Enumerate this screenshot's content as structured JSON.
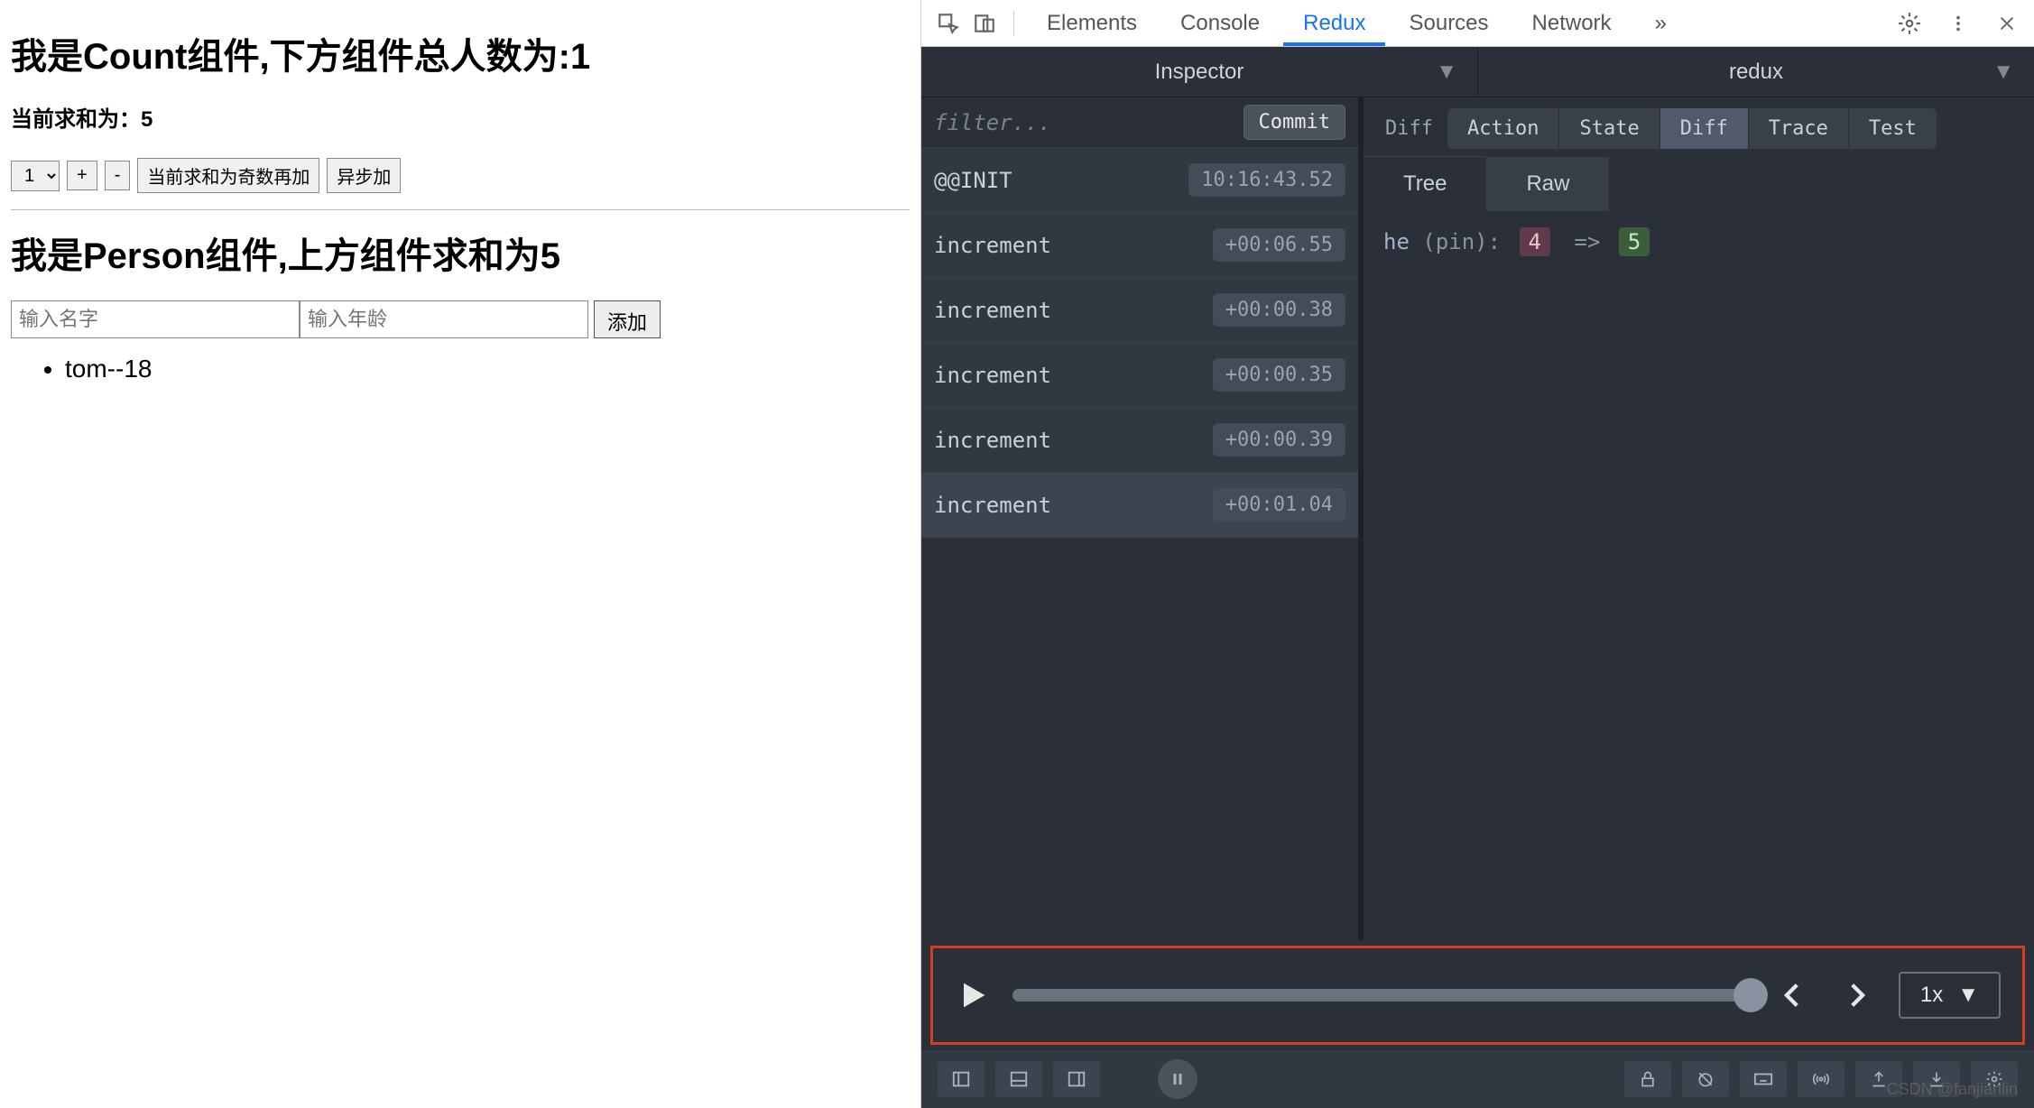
{
  "app": {
    "count_heading": "我是Count组件,下方组件总人数为:1",
    "sum_line": "当前求和为：5",
    "select_value": "1",
    "inc_btn": "+",
    "dec_btn": "-",
    "odd_btn": "当前求和为奇数再加",
    "async_btn": "异步加",
    "person_heading": "我是Person组件,上方组件求和为5",
    "name_placeholder": "输入名字",
    "age_placeholder": "输入年龄",
    "add_btn": "添加",
    "persons": [
      "tom--18"
    ]
  },
  "devtools": {
    "tabs": [
      "Elements",
      "Console",
      "Redux",
      "Sources",
      "Network"
    ],
    "active_tab": "Redux",
    "more": "»"
  },
  "redux": {
    "selectors": {
      "left": "Inspector",
      "right": "redux"
    },
    "filter_placeholder": "filter...",
    "commit": "Commit",
    "actions": [
      {
        "name": "@@INIT",
        "time": "10:16:43.52",
        "selected": false
      },
      {
        "name": "increment",
        "time": "+00:06.55",
        "selected": false
      },
      {
        "name": "increment",
        "time": "+00:00.38",
        "selected": false
      },
      {
        "name": "increment",
        "time": "+00:00.35",
        "selected": false
      },
      {
        "name": "increment",
        "time": "+00:00.39",
        "selected": false
      },
      {
        "name": "increment",
        "time": "+00:01.04",
        "selected": true
      }
    ],
    "view_label": "Diff",
    "view_tabs": [
      "Action",
      "State",
      "Diff",
      "Trace",
      "Test"
    ],
    "view_active": "Diff",
    "subview_tabs": [
      "Tree",
      "Raw"
    ],
    "subview_active": "Tree",
    "diff": {
      "key": "he",
      "pin": "(pin):",
      "old": "4",
      "arrow": "=>",
      "new": "5"
    },
    "playback_speed": "1x"
  },
  "watermark": "CSDN @fanjianlin"
}
